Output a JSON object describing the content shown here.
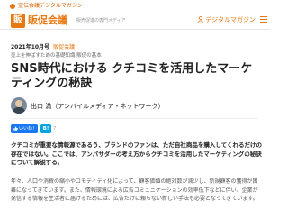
{
  "topbar": {
    "label": "宣伝会議デジタルマガジン"
  },
  "brand": {
    "logo_char": "販",
    "name": "販促会議",
    "tagline": "販売促進の専門メディア",
    "magazine_link": "デジタルマガジン"
  },
  "article": {
    "issue": "2021年10月号",
    "category": "販促会議",
    "subtitle": "売上を伸ばすための基礎知識 販促の基本",
    "title": "SNS時代における クチコミを活用したマーケティングの秘訣",
    "author": "出口 満（アンバイルメディア・ネットワーク）",
    "like_label": "いいね！ 13",
    "hatena_label": "B!",
    "bookmark_count": "7",
    "lead": "クチコミが重要な情報源であるう、ブランドのファンは、ただ自社商品を購入してくれるだけの存在ではない。ここでは、アンバサダーの考え方からクチコミを活用したマーケティングの秘訣について解説する。",
    "body": "年々、人口や消費の縮小やコモディティ化によって、顧客価値の絶対数が減少し、新規顧客の獲得が困難になってきています。また、情報環境による広告コミュニケーションの効率低下などに伴い、企業が発信する情報を生活者に届けるためには、広告だけに頼らない新しい手法も必要となってきています。"
  }
}
